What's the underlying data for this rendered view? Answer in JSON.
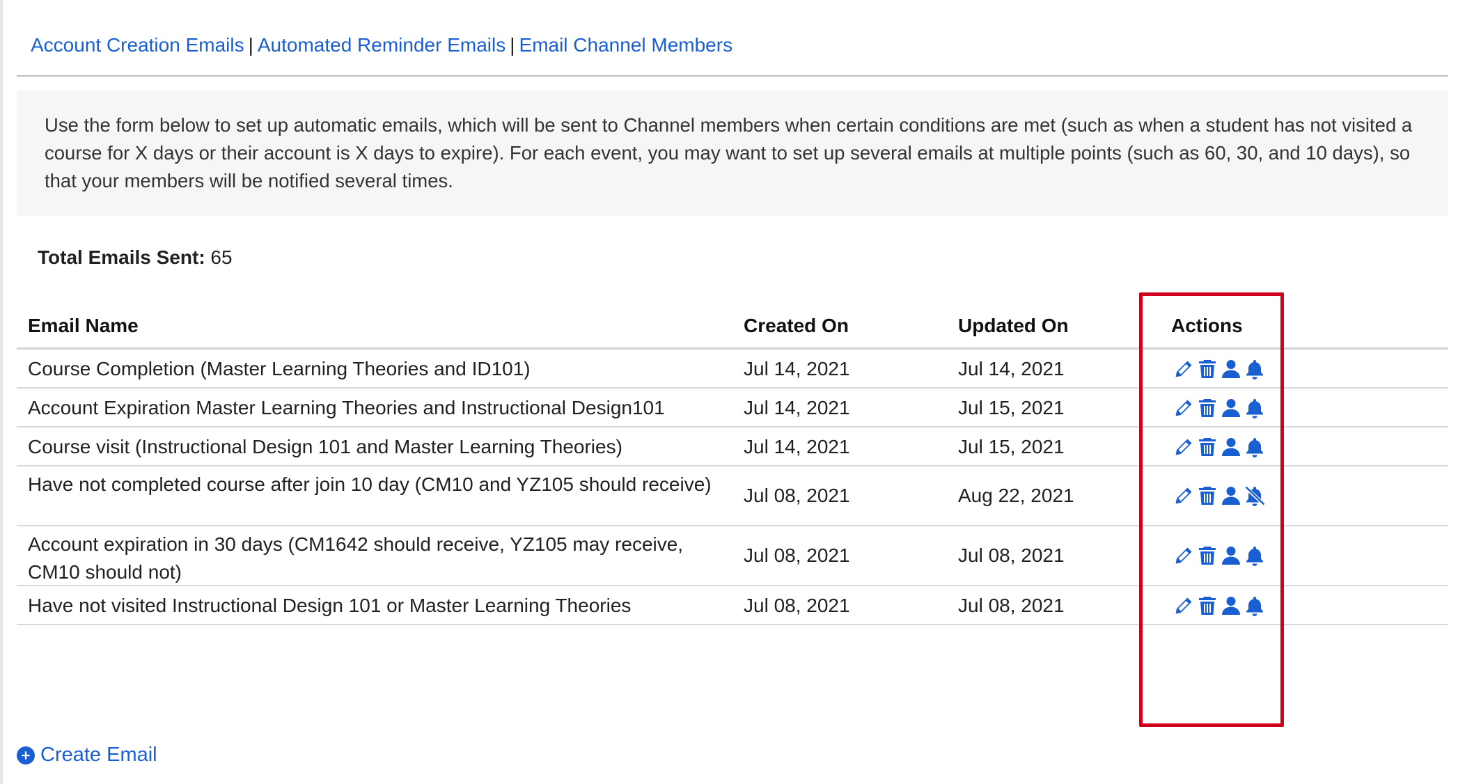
{
  "nav": {
    "links": [
      "Account Creation Emails",
      "Automated Reminder Emails",
      "Email Channel Members"
    ],
    "separator": "|"
  },
  "info": {
    "text": "Use the form below to set up automatic emails, which will be sent to Channel members when certain conditions are met (such as when a student has not visited a course for X days or their account is X days to expire). For each event, you may want to set up several emails at multiple points (such as 60, 30, and 10 days), so that your members will be notified several times."
  },
  "total": {
    "label": "Total Emails Sent:",
    "value": "65"
  },
  "table": {
    "headers": {
      "name": "Email Name",
      "created": "Created On",
      "updated": "Updated On",
      "actions": "Actions"
    },
    "rows": [
      {
        "name": "Course Completion (Master Learning Theories and ID101)",
        "created": "Jul 14, 2021",
        "updated": "Jul 14, 2021",
        "notify": "bell-icon"
      },
      {
        "name": "Account Expiration Master Learning Theories and Instructional Design101",
        "created": "Jul 14, 2021",
        "updated": "Jul 15, 2021",
        "notify": "bell-icon"
      },
      {
        "name": "Course visit (Instructional Design 101 and Master Learning Theories)",
        "created": "Jul 14, 2021",
        "updated": "Jul 15, 2021",
        "notify": "bell-icon"
      },
      {
        "name": "Have not completed course after join 10 day (CM10 and YZ105 should receive)",
        "created": "Jul 08, 2021",
        "updated": "Aug 22, 2021",
        "notify": "bell-slash-icon"
      },
      {
        "name": "Account expiration in 30 days (CM1642 should receive, YZ105 may receive, CM10 should not)",
        "created": "Jul 08, 2021",
        "updated": "Jul 08, 2021",
        "notify": "bell-icon"
      },
      {
        "name": "Have not visited Instructional Design 101 or Master Learning Theories",
        "created": "Jul 08, 2021",
        "updated": "Jul 08, 2021",
        "notify": "bell-icon"
      }
    ],
    "action_icons": [
      "pencil-icon",
      "trash-icon",
      "user-icon"
    ]
  },
  "create": {
    "label": "Create Email",
    "icon": "plus-circle-icon"
  },
  "colors": {
    "link": "#1a5fd1",
    "highlight": "#d0021b",
    "panel": "#f6f6f6"
  }
}
